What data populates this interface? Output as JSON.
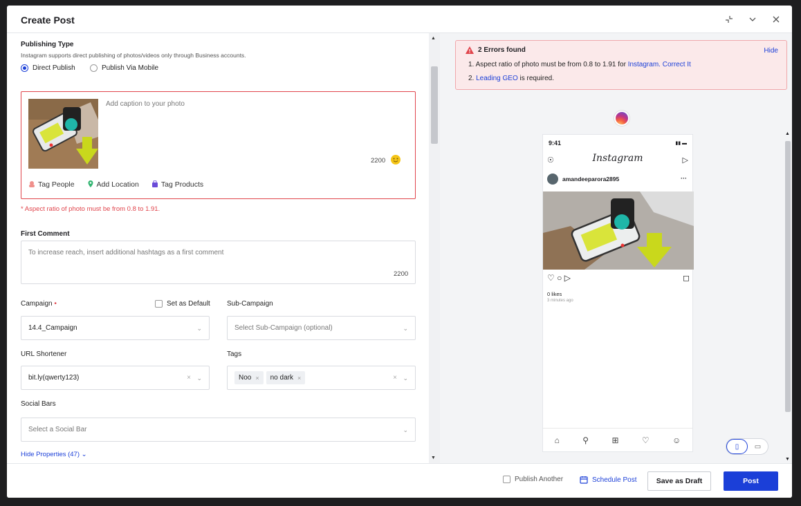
{
  "header": {
    "title": "Create Post"
  },
  "publishing": {
    "label": "Publishing Type",
    "note": "Instagram supports direct publishing of photos/videos only through Business accounts.",
    "options": [
      "Direct Publish",
      "Publish Via Mobile"
    ],
    "selected": "Direct Publish"
  },
  "caption": {
    "placeholder": "Add caption to your photo",
    "count": "2200",
    "tags": [
      "Tag People",
      "Add Location",
      "Tag Products"
    ],
    "error": "* Aspect ratio of photo must be from 0.8 to 1.91."
  },
  "first_comment": {
    "label": "First Comment",
    "placeholder": "To increase reach, insert additional hashtags as a first comment",
    "count": "2200"
  },
  "campaign": {
    "label": "Campaign",
    "required": "•",
    "set_default": "Set as Default",
    "value": "14.4_Campaign"
  },
  "sub_campaign": {
    "label": "Sub-Campaign",
    "placeholder": "Select Sub-Campaign (optional)"
  },
  "url_shortener": {
    "label": "URL Shortener",
    "value": "bit.ly(qwerty123)"
  },
  "tags": {
    "label": "Tags",
    "chips": [
      "Noo",
      "no dark"
    ]
  },
  "social_bars": {
    "label": "Social Bars",
    "placeholder": "Select a Social Bar"
  },
  "hide_props": "Hide Properties (47)",
  "errors": {
    "title": "2 Errors found",
    "hide": "Hide",
    "line1_text": "1. Aspect ratio of photo must be from 0.8 to 1.91 for",
    "line1_link1": "Instagram.",
    "line1_link2": "Correct It",
    "line2_prefix": "2.",
    "line2_link": "Leading GEO",
    "line2_text": "is required."
  },
  "preview": {
    "time": "9:41",
    "app_name": "Instagram",
    "username": "amandeeparora2895",
    "likes": "0 likes",
    "posted": "3 minutes ago"
  },
  "footer": {
    "publish_another": "Publish Another",
    "schedule": "Schedule Post",
    "draft": "Save as Draft",
    "post": "Post"
  },
  "colors": {
    "accent": "#1b3fd8",
    "error": "#e0444b"
  }
}
